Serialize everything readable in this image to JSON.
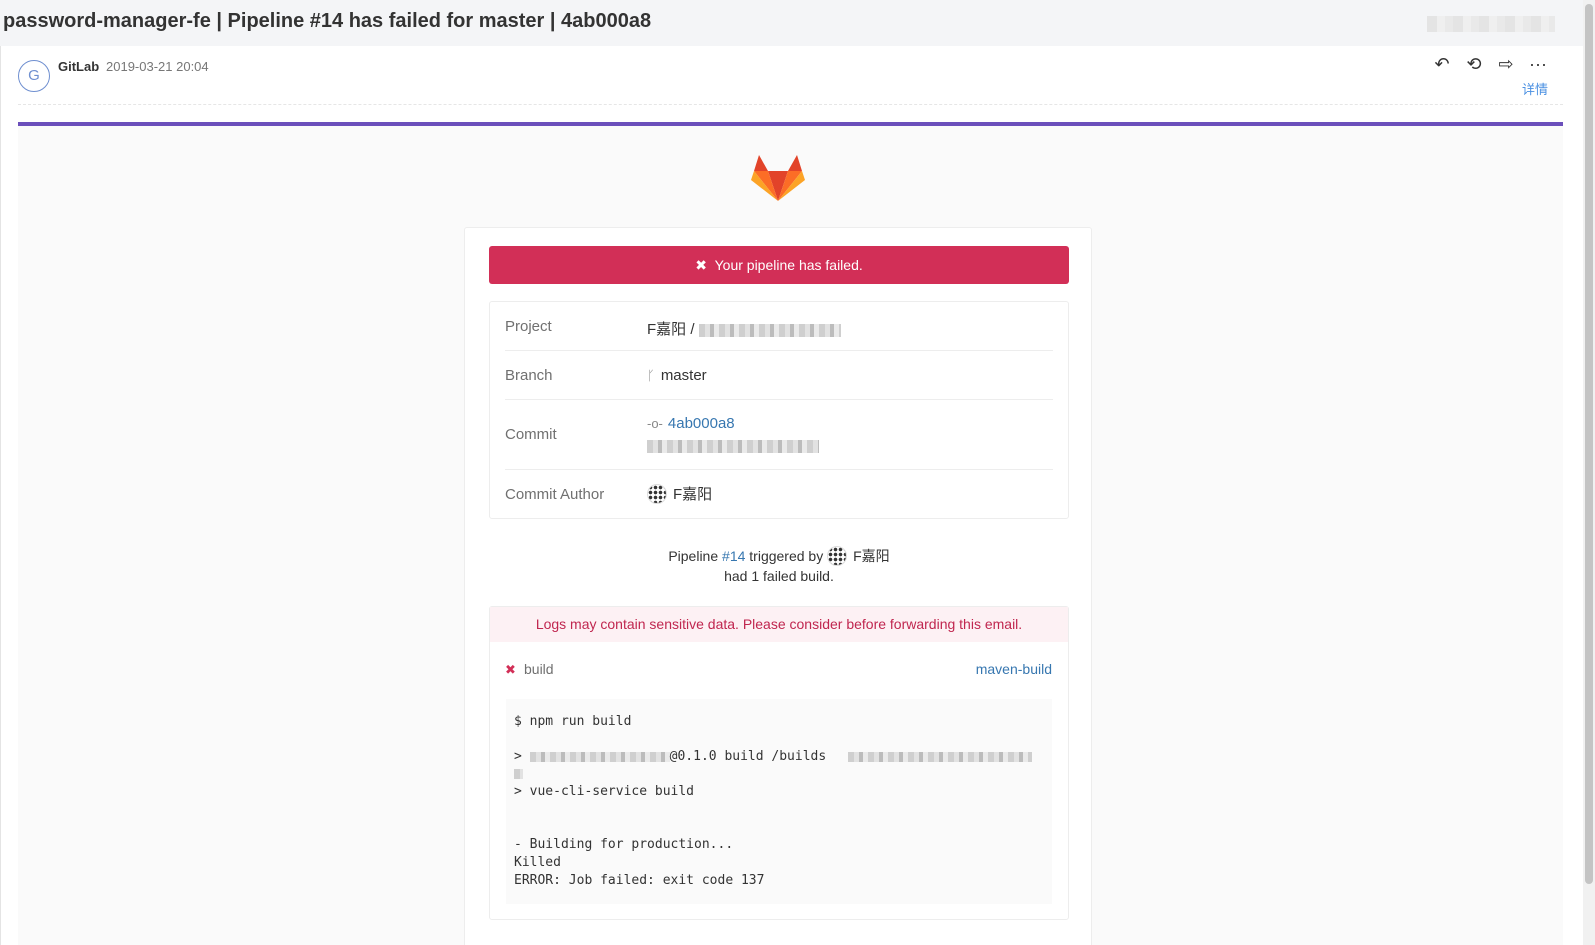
{
  "subject": "password-manager-fe | Pipeline #14 has failed for master | 4ab000a8",
  "mail": {
    "avatar_letter": "G",
    "sender": "GitLab",
    "date": "2019-03-21 20:04",
    "actions": [
      "↶",
      "⟲",
      "⇨",
      "···"
    ],
    "details_label": "详情"
  },
  "colors": {
    "accent_bar": "#6b4fbb",
    "alert_bg": "#d22f57",
    "link": "#3777b0"
  },
  "alert": {
    "icon": "✖",
    "text": "Your pipeline has failed."
  },
  "info": {
    "project_label": "Project",
    "project_value": "F嘉阳 /",
    "branch_label": "Branch",
    "branch_icon": "branch-icon",
    "branch_value": "master",
    "commit_label": "Commit",
    "commit_icon": "commit-icon",
    "commit_value": "4ab000a8",
    "author_label": "Commit Author",
    "author_value": "F嘉阳"
  },
  "summary": {
    "prefix": "Pipeline",
    "pipeline_link": "#14",
    "triggered_by": "triggered by",
    "user": "F嘉阳",
    "line2": "had 1 failed build."
  },
  "logs": {
    "warning": "Logs may contain sensitive data. Please consider before forwarding this email.",
    "job_status_icon": "✖",
    "job_name": "build",
    "job_stage": "maven-build",
    "lines": {
      "l1": "$ npm run build",
      "l2_prefix": ">",
      "l2_mid": "@0.1.0 build /builds",
      "l3": "> vue-cli-service build",
      "l4": "-  Building for production...",
      "l5": "Killed",
      "l6": "ERROR: Job failed: exit code 137"
    }
  }
}
